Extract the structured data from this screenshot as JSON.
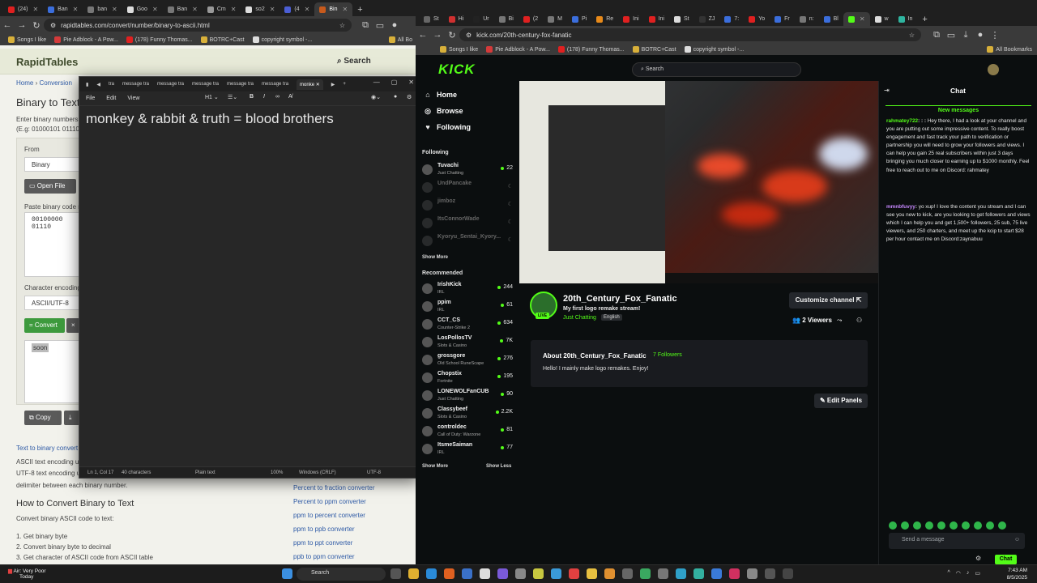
{
  "left_browser": {
    "tabs": [
      {
        "label": "(24)",
        "color": "#e02020"
      },
      {
        "label": "Ban",
        "color": "#3b6edc"
      },
      {
        "label": "ban",
        "color": "#666"
      },
      {
        "label": "Goo",
        "color": "#666"
      },
      {
        "label": "Ban",
        "color": "#666"
      },
      {
        "label": "Cm",
        "color": "#888"
      },
      {
        "label": "so2",
        "color": "#666"
      },
      {
        "label": "(4",
        "color": "#4b5ed4"
      },
      {
        "label": "Bin",
        "color": "#c85a1c"
      }
    ],
    "new_tab": "+",
    "url": "rapidtables.com/convert/number/binary-to-ascii.html",
    "bookmarks": [
      "Songs I like",
      "Pie Adblock - A Pow...",
      "(178) Funny Thomas...",
      "BOTRC+Cast",
      "copyright symbol -..."
    ],
    "all_bookmarks": "All Bo",
    "site_logo": "RapidTables",
    "site_search": "Search",
    "breadcrumb_home": "Home",
    "breadcrumb_sep": " › ",
    "breadcrumb_conv": "Conversion",
    "page_title": "Binary to Text",
    "desc_line1": "Enter binary numbers",
    "desc_line2": "(E.g: 01000101 01110",
    "from_label": "From",
    "from_value": "Binary",
    "open_file": "Open File",
    "paste_label": "Paste binary code n",
    "binary_value": "00100000 01110",
    "charenc_label": "Character encoding",
    "charenc_value": "ASCII/UTF-8",
    "convert": "= Convert",
    "reset": "×",
    "output": "soon",
    "copy": "Copy",
    "link_text_to_binary": "Text to binary convert",
    "text_lines": [
      "ASCII text encoding u",
      "UTF-8 text encoding u",
      "delimiter between each binary number."
    ],
    "related": [
      "Percent to fraction converter",
      "Percent to ppm converter",
      "ppm to percent converter",
      "ppm to ppb converter",
      "ppm to ppt converter",
      "ppb to ppm converter"
    ],
    "how_title": "How to Convert Binary to Text",
    "how_desc": "Convert binary ASCII code to text:",
    "steps": [
      "1. Get binary byte",
      "2. Convert binary byte to decimal",
      "3. Get character of ASCII code from ASCII table"
    ]
  },
  "notepad": {
    "tabs": [
      "tra",
      "message tra",
      "message tra",
      "message tra",
      "message tra",
      "message tra",
      "monke"
    ],
    "menu": [
      "File",
      "Edit",
      "View"
    ],
    "heading_tool": "H1",
    "content": "monkey & rabbit & truth = blood brothers",
    "status": {
      "pos": "Ln 1, Col 17",
      "chars": "40 characters",
      "format": "Plain text",
      "zoom": "100%",
      "eol": "Windows (CRLF)",
      "enc": "UTF-8"
    }
  },
  "right_browser": {
    "url": "kick.com/20th-century-fox-fanatic",
    "bookmarks": [
      "Songs I like",
      "Pie Adblock - A Pow...",
      "(178) Funny Thomas...",
      "BOTRC+Cast",
      "copyright symbol -..."
    ],
    "all_bookmarks": "All Bookmarks",
    "tabs": [
      "St",
      "Hi",
      "Ur",
      "Bi",
      "(2",
      "M",
      "Pi",
      "Re",
      "Ini",
      "Ini",
      "St",
      "ZJ",
      "7:",
      "Yo",
      "Fr",
      "n:",
      "Bl",
      "",
      "w",
      "In"
    ]
  },
  "kick": {
    "logo": "KICK",
    "nav": [
      "Home",
      "Browse",
      "Following"
    ],
    "search_placeholder": "Search",
    "following_title": "Following",
    "following": [
      {
        "name": "Tuvachi",
        "category": "Just Chatting",
        "viewers": "22",
        "live": true
      },
      {
        "name": "UndPancake",
        "category": "",
        "viewers": "",
        "live": false
      },
      {
        "name": "jimboz",
        "category": "",
        "viewers": "",
        "live": false
      },
      {
        "name": "ItsConnorWade",
        "category": "",
        "viewers": "",
        "live": false
      },
      {
        "name": "Kyoryu_Sentai_Kyory...",
        "category": "",
        "viewers": "",
        "live": false
      }
    ],
    "show_more": "Show More",
    "recommended_title": "Recommended",
    "recommended": [
      {
        "name": "IrishKick",
        "category": "IRL",
        "viewers": "244"
      },
      {
        "name": "ppim",
        "category": "IRL",
        "viewers": "61"
      },
      {
        "name": "CCT_CS",
        "category": "Counter-Strike 2",
        "viewers": "634"
      },
      {
        "name": "LosPollosTV",
        "category": "Slots & Casino",
        "viewers": "7K"
      },
      {
        "name": "grossgore",
        "category": "Old School RuneScape",
        "viewers": "276"
      },
      {
        "name": "Chopstix",
        "category": "Fortnite",
        "viewers": "195"
      },
      {
        "name": "LONEWOLFanCUB",
        "category": "Just Chatting",
        "viewers": "90"
      },
      {
        "name": "Classybeef",
        "category": "Slots & Casino",
        "viewers": "2.2K"
      },
      {
        "name": "controldec",
        "category": "Call of Duty: Warzone",
        "viewers": "81"
      },
      {
        "name": "ItsmeSaiman",
        "category": "IRL",
        "viewers": "77"
      }
    ],
    "show_more2": "Show More",
    "show_less": "Show Less",
    "channel_name": "20th_Century_Fox_Fanatic",
    "stream_title": "My first logo remake stream!",
    "category": "Just Chatting",
    "tag": "English",
    "live_badge": "LIVE",
    "customize": "Customize channel",
    "viewers": "2 Viewers",
    "about_title": "About 20th_Century_Fox_Fanatic",
    "followers": "7 Followers",
    "about_desc": "Hello! I mainly make logo remakes. Enjoy!",
    "edit_panels": "Edit Panels",
    "chat_title": "Chat",
    "new_messages": "New messages",
    "messages": [
      {
        "user": "rahmatey722",
        "color": "#53fc18",
        "text": "Hey there, I had a look at your channel and you are putting out some impressive content. To really boost engagement and fast track your path to verification or partnership you will need to grow your followers and views. I can help you gain 25 real subscribers within just 3 days bringing you much closer to earning up to $1000 monthly. Feel free to reach out to me on Discord: rahmatey"
      },
      {
        "user": "mmnbfuvyy",
        "color": "#c788ff",
        "text": "yo xup! I love the content you stream and I can see you new to kick, are you looking to get followers and views which I can help you and get 1,500+ followers, 25 sub, 75 live viewers, and 250 charters, and meet up the kcip to start $28 per hour contact me on Discord:zaynabuu"
      }
    ],
    "send_placeholder": "Send a message",
    "chat_button": "Chat"
  },
  "taskbar": {
    "weather": "Air: Very Poor",
    "weather_sub": "Today",
    "search": "Search",
    "time": "7:43 AM",
    "date": "8/5/2025"
  }
}
